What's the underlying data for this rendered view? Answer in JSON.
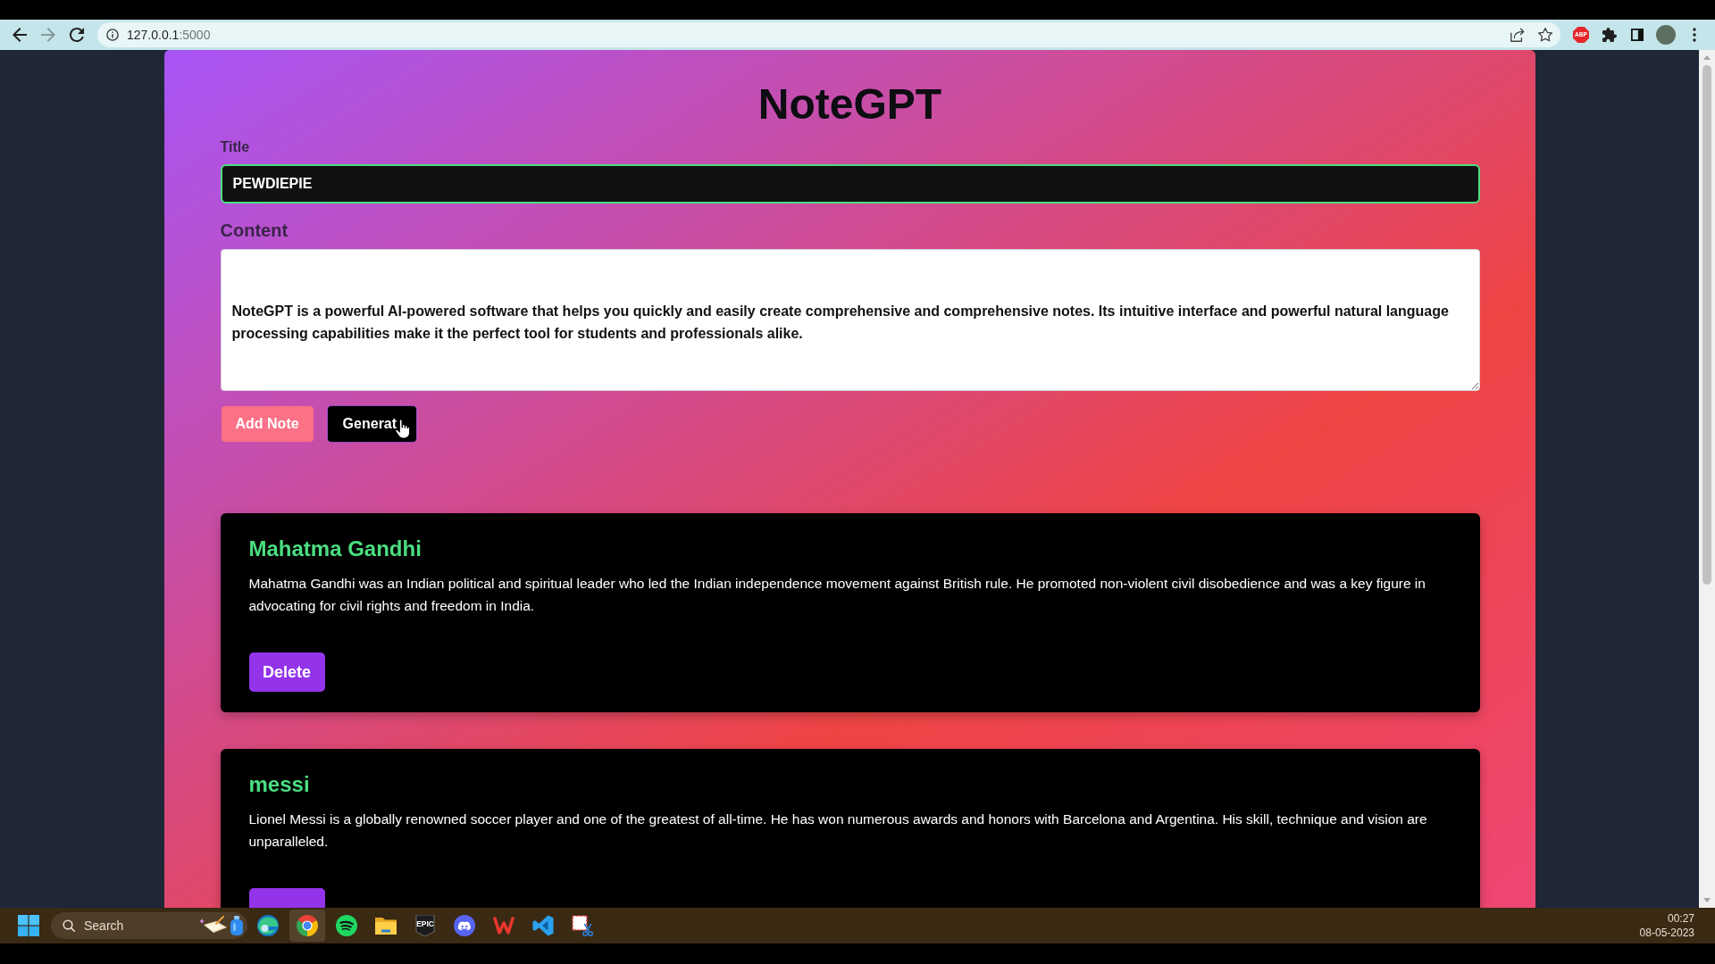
{
  "browser": {
    "address": {
      "host": "127.0.0.1",
      "port": ":5000"
    },
    "forward_disabled": true,
    "extension_badge": "ABP"
  },
  "app": {
    "heading": "NoteGPT",
    "form": {
      "title": {
        "label": "Title",
        "value": "PEWDIEPIE",
        "focused": true
      },
      "content": {
        "label": "Content",
        "value": "NoteGPT is a powerful AI-powered software that helps you quickly and easily create comprehensive and comprehensive notes. Its intuitive interface and powerful natural language processing capabilities make it the perfect tool for students and professionals alike."
      },
      "buttons": [
        {
          "kind": "add",
          "label": "Add Note",
          "hovered": false
        },
        {
          "kind": "generate",
          "label": "Generat",
          "hovered": true
        }
      ]
    },
    "notes": [
      {
        "title": "Mahatma Gandhi",
        "body": "Mahatma Gandhi was an Indian political and spiritual leader who led the Indian independence movement against British rule. He promoted non-violent civil disobedience and was a key figure in advocating for civil rights and freedom in India.",
        "delete_label": "Delete"
      },
      {
        "title": "messi",
        "body": "Lionel Messi is a globally renowned soccer player and one of the greatest of all-time. He has won numerous awards and honors with Barcelona and Argentina. His skill, technique and vision are unparalleled."
      }
    ]
  },
  "taskbar": {
    "search": {
      "placeholder": "Search"
    },
    "apps": [
      {
        "kind": "swirl",
        "selected": false
      },
      {
        "kind": "segmented-ring",
        "selected": true
      },
      {
        "kind": "arcs-circle",
        "selected": false
      },
      {
        "kind": "folder",
        "selected": false
      },
      {
        "kind": "shield",
        "selected": false,
        "label": "EPIC"
      },
      {
        "kind": "controller",
        "selected": false
      },
      {
        "kind": "zigzag",
        "selected": false
      },
      {
        "kind": "ribbon",
        "selected": false
      },
      {
        "kind": "scissors",
        "selected": false
      }
    ],
    "clock": {
      "time": "00:27",
      "date": "08-05-2023"
    }
  }
}
